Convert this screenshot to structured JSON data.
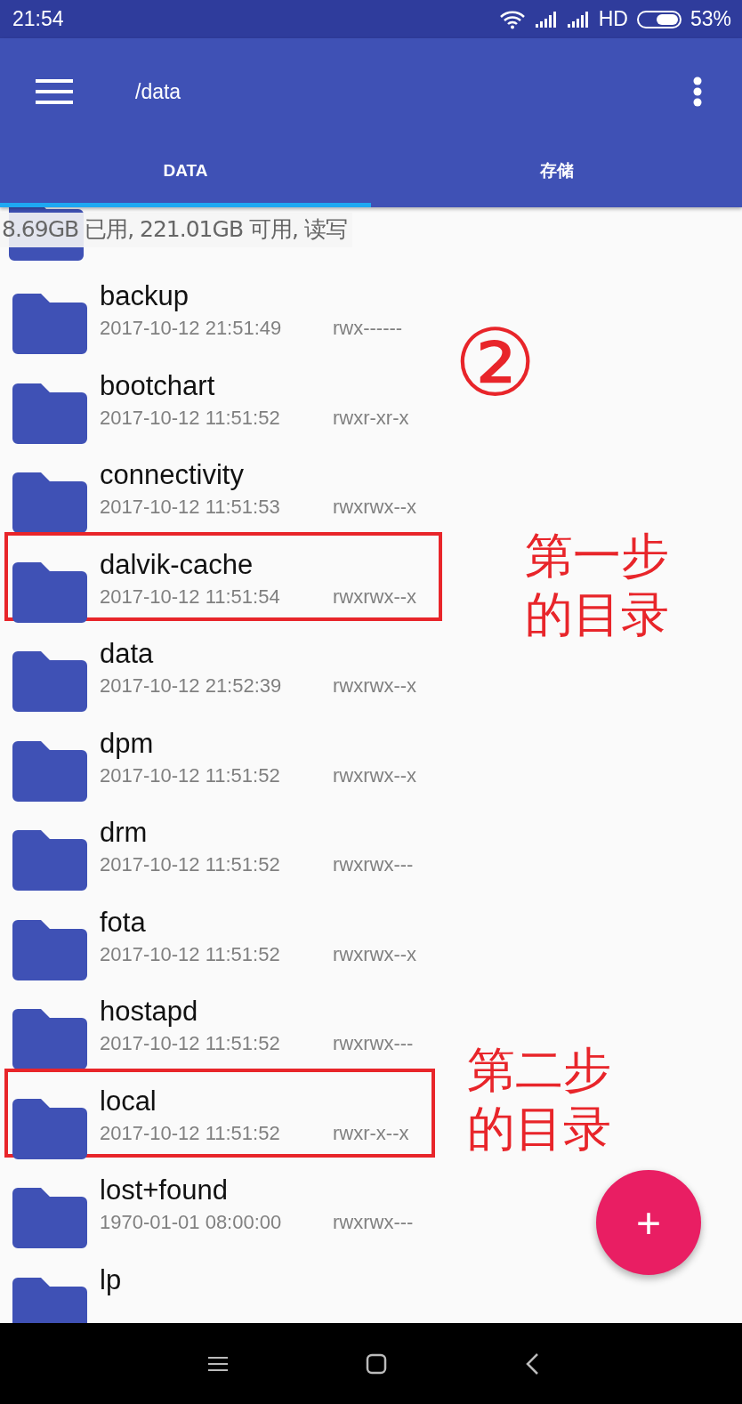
{
  "status_bar": {
    "time": "21:54",
    "network": "HD",
    "battery": "53%"
  },
  "toolbar": {
    "title": "/data"
  },
  "tabs": [
    {
      "label": "DATA",
      "selected": true
    },
    {
      "label": "存储",
      "selected": false
    }
  ],
  "storage_info": "8.69GB 已用, 221.01GB 可用, 读写",
  "files": [
    {
      "name": "backup",
      "date": "2017-10-12 21:51:49",
      "permissions": "rwx------",
      "marked": false,
      "note": {
        "kind": "circled",
        "lines": [
          "②"
        ]
      }
    },
    {
      "name": "bootchart",
      "date": "2017-10-12 11:51:52",
      "permissions": "rwxr-xr-x",
      "marked": false
    },
    {
      "name": "connectivity",
      "date": "2017-10-12 11:51:53",
      "permissions": "rwxrwx--x",
      "marked": false
    },
    {
      "name": "dalvik-cache",
      "date": "2017-10-12 11:51:54",
      "permissions": "rwxrwx--x",
      "marked": true,
      "note": {
        "kind": "label",
        "lines": [
          "第一步",
          "的目录"
        ]
      }
    },
    {
      "name": "data",
      "date": "2017-10-12 21:52:39",
      "permissions": "rwxrwx--x",
      "marked": false
    },
    {
      "name": "dpm",
      "date": "2017-10-12 11:51:52",
      "permissions": "rwxrwx--x",
      "marked": false
    },
    {
      "name": "drm",
      "date": "2017-10-12 11:51:52",
      "permissions": "rwxrwx---",
      "marked": false
    },
    {
      "name": "fota",
      "date": "2017-10-12 11:51:52",
      "permissions": "rwxrwx--x",
      "marked": false
    },
    {
      "name": "hostapd",
      "date": "2017-10-12 11:51:52",
      "permissions": "rwxrwx---",
      "marked": false
    },
    {
      "name": "local",
      "date": "2017-10-12 11:51:52",
      "permissions": "rwxr-x--x",
      "marked": true,
      "note": {
        "kind": "label",
        "lines": [
          "第二步",
          "的目录"
        ]
      }
    },
    {
      "name": "lost+found",
      "date": "1970-01-01 08:00:00",
      "permissions": "rwxrwx---",
      "marked": false
    },
    {
      "name": "lp",
      "marked": false
    }
  ],
  "fab": {
    "label": "+"
  }
}
